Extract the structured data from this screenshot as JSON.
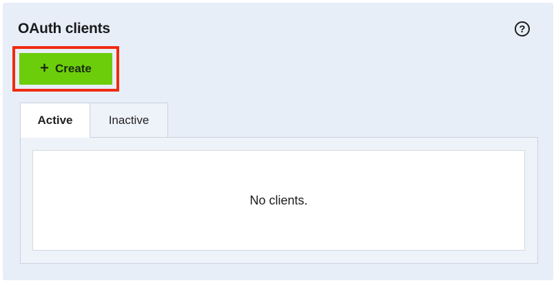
{
  "header": {
    "title": "OAuth clients",
    "help_icon": "question-circle-icon",
    "help_glyph": "?"
  },
  "toolbar": {
    "create_label": "Create",
    "create_icon": "plus-icon",
    "create_glyph": "+",
    "create_color": "#6cce0a",
    "highlight_color": "#f02a10"
  },
  "tabs": [
    {
      "label": "Active",
      "selected": true
    },
    {
      "label": "Inactive",
      "selected": false
    }
  ],
  "main": {
    "empty_message": "No clients."
  }
}
